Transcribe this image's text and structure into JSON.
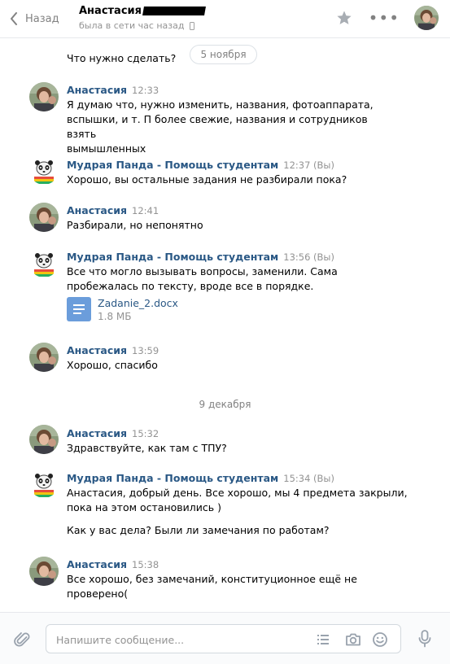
{
  "header": {
    "back_label": "Назад",
    "peer_name": "Анастасия",
    "peer_status": "была в сети час назад"
  },
  "top_cut_text": "Что нужно сделать?",
  "top_cut_visible": "Что нужно сделать?",
  "date_pill": "5 ноября",
  "date_separator": "9 декабря",
  "messages": [
    {
      "author": "Анастасия",
      "time": "12:33",
      "lines": [
        "Я думаю что, нужно изменить, названия, фотоаппарата,",
        "вспышки, и т. П более свежие, названия и сотрудников взять",
        "вымышленных"
      ]
    },
    {
      "author": "Мудрая Панда - Помощь студентам",
      "time": "12:37 (Вы)",
      "lines": [
        "Хорошо, вы остальные задания не разбирали пока?"
      ]
    },
    {
      "author": "Анастасия",
      "time": "12:41",
      "lines": [
        "Разбирали, но непонятно"
      ]
    },
    {
      "author": "Мудрая Панда - Помощь студентам",
      "time": "13:56 (Вы)",
      "lines": [
        "Все что могло вызывать вопросы, заменили. Сама",
        "пробежалась по тексту, вроде все в порядке."
      ],
      "attachment": {
        "name": "Zadanie_2.docx",
        "size": "1.8 МБ"
      }
    },
    {
      "author": "Анастасия",
      "time": "13:59",
      "lines": [
        "Хорошо, спасибо"
      ]
    },
    {
      "author": "Анастасия",
      "time": "15:32",
      "lines": [
        "Здравствуйте, как там с ТПУ?"
      ]
    },
    {
      "author": "Мудрая Панда - Помощь студентам",
      "time": "15:34 (Вы)",
      "lines": [
        "Анастасия, добрый день. Все хорошо, мы 4 предмета закрыли,",
        "пока на этом остановились )",
        "",
        "Как у вас дела? Были ли замечания по работам?"
      ]
    },
    {
      "author": "Анастасия",
      "time": "15:38",
      "lines": [
        "Все хорошо, без замечаний, конституционное ещё не",
        "проверено("
      ]
    }
  ],
  "composer": {
    "placeholder": "Напишите сообщение..."
  },
  "colors": {
    "link": "#2a5885",
    "muted": "#939393",
    "doc_icon": "#6b9ddb"
  },
  "icons": [
    "chevron-left-icon",
    "star-icon",
    "more-icon",
    "phone-icon",
    "paperclip-icon",
    "list-icon",
    "camera-icon",
    "smile-icon",
    "microphone-icon",
    "document-icon"
  ]
}
